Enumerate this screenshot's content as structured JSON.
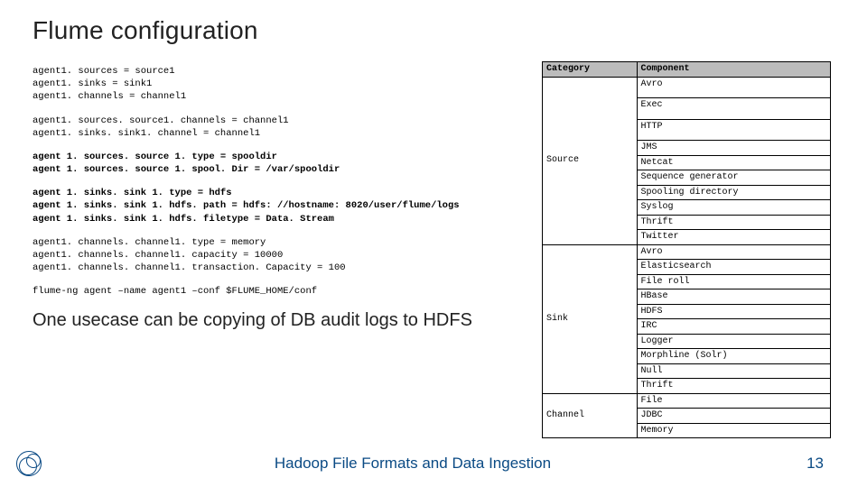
{
  "title": "Flume configuration",
  "code": {
    "block1": "agent1. sources = source1\nagent1. sinks = sink1\nagent1. channels = channel1",
    "block2": "agent1. sources. source1. channels = channel1\nagent1. sinks. sink1. channel = channel1",
    "block3": "agent 1. sources. source 1. type = spooldir\nagent 1. sources. source 1. spool. Dir = /var/spooldir",
    "block4": "agent 1. sinks. sink 1. type = hdfs\nagent 1. sinks. sink 1. hdfs. path = hdfs: //hostname: 8020/user/flume/logs\nagent 1. sinks. sink 1. hdfs. filetype = Data. Stream",
    "block5": "agent1. channels. channel1. type = memory\nagent1. channels. channel1. capacity = 10000\nagent1. channels. channel1. transaction. Capacity = 100",
    "block6": "flume-ng agent –name agent1 –conf $FLUME_HOME/conf"
  },
  "usecase": "One usecase can be copying of DB audit logs to HDFS",
  "table": {
    "headers": {
      "category": "Category",
      "component": "Component"
    },
    "rows": [
      {
        "category": "",
        "component": "Avro",
        "group": "src",
        "height": 2
      },
      {
        "category": "",
        "component": "Exec",
        "group": "src",
        "height": 2
      },
      {
        "category": "",
        "component": "HTTP",
        "group": "src",
        "height": 2
      },
      {
        "category": "Source",
        "component": "JMS",
        "group": "src",
        "height": 1,
        "span_start": true,
        "span": 8
      },
      {
        "category": "",
        "component": "Netcat",
        "group": "src",
        "height": 1
      },
      {
        "category": "",
        "component": "Sequence generator",
        "group": "src",
        "height": 1
      },
      {
        "category": "",
        "component": "Spooling directory",
        "group": "src",
        "height": 1
      },
      {
        "category": "",
        "component": "Syslog",
        "group": "src",
        "height": 1
      },
      {
        "category": "",
        "component": "Thrift",
        "group": "src",
        "height": 1
      },
      {
        "category": "",
        "component": "Twitter",
        "group": "src",
        "height": 1
      },
      {
        "category": "",
        "component": "Avro",
        "group": "snk",
        "height": 1
      },
      {
        "category": "",
        "component": "Elasticsearch",
        "group": "snk",
        "height": 1
      },
      {
        "category": "",
        "component": "File roll",
        "group": "snk",
        "height": 1
      },
      {
        "category": "",
        "component": "HBase",
        "group": "snk",
        "height": 1
      },
      {
        "category": "",
        "component": "HDFS",
        "group": "snk",
        "height": 1
      },
      {
        "category": "Sink",
        "component": "IRC",
        "group": "snk",
        "height": 1
      },
      {
        "category": "",
        "component": "Logger",
        "group": "snk",
        "height": 1
      },
      {
        "category": "",
        "component": "Morphline (Solr)",
        "group": "snk",
        "height": 1
      },
      {
        "category": "",
        "component": "Null",
        "group": "snk",
        "height": 1
      },
      {
        "category": "",
        "component": "Thrift",
        "group": "snk",
        "height": 1
      },
      {
        "category": "",
        "component": "File",
        "group": "ch",
        "height": 1
      },
      {
        "category": "Channel",
        "component": "JDBC",
        "group": "ch",
        "height": 1
      },
      {
        "category": "",
        "component": "Memory",
        "group": "ch",
        "height": 1
      }
    ]
  },
  "footer": {
    "center": "Hadoop File Formats and Data Ingestion",
    "page": "13"
  }
}
